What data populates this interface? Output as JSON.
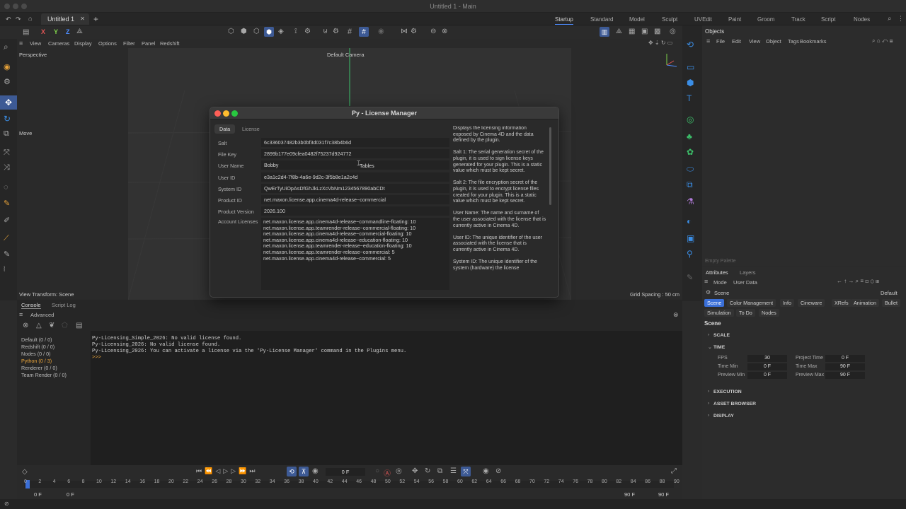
{
  "window": {
    "title": "Untitled 1 - Main"
  },
  "tabs": {
    "document_tab": "Untitled 1",
    "close": "✕",
    "add": "+"
  },
  "layouts": [
    "Startup",
    "Standard",
    "Model",
    "Sculpt",
    "UVEdit",
    "Paint",
    "Groom",
    "Track",
    "Script",
    "Nodes"
  ],
  "active_layout": "Startup",
  "viewport_menu": [
    "View",
    "Cameras",
    "Display",
    "Options",
    "Filter",
    "Panel",
    "Redshift"
  ],
  "viewport": {
    "label": "Perspective",
    "camera": "Default Camera",
    "move_tool": "Move",
    "view_transform": "View Transform: Scene",
    "grid_spacing": "Grid Spacing : 50 cm"
  },
  "axis": {
    "x": "X",
    "y": "Y",
    "z": "Z"
  },
  "dialog": {
    "title": "Py - License Manager",
    "tabs": [
      "Data",
      "License"
    ],
    "fields": [
      {
        "label": "Salt",
        "value": "6c336037482b3b0bf3d031f7c38b4b6d"
      },
      {
        "label": "File Key",
        "value": "2899b177e09cfea0482f75237d924772"
      },
      {
        "label": "User Name",
        "value": "Bobby"
      },
      {
        "label": "User ID",
        "value": "e3a1c2d4-7f8b-4a6e-9d2c-3f5b8e1a2c4d"
      },
      {
        "label": "System ID",
        "value": "QwErTyUiOpAsDfGhJkLzXcVbNm1234567890abCDt"
      },
      {
        "label": "Product ID",
        "value": "net.maxon.license.app.cinema4d-release~commercial"
      },
      {
        "label": "Product Version",
        "value": "2026.100"
      }
    ],
    "cursor_tooltip": "Tables",
    "account_licenses_label": "Account Licenses",
    "account_licenses": [
      "net.maxon.license.app.cinema4d-release~commandline-floating: 10",
      "net.maxon.license.app.teamrender-release~commercial-floating: 10",
      "net.maxon.license.app.cinema4d-release~commercial-floating: 10",
      "net.maxon.license.app.cinema4d-release~education-floating: 10",
      "net.maxon.license.app.teamrender-release~education-floating: 10",
      "net.maxon.license.app.teamrender-release~commercial: 5",
      "net.maxon.license.app.cinema4d-release~commercial: 5"
    ],
    "help": [
      "Displays the licensing information exposed by Cinema 4D and the data defined by the plugin.",
      "Salt 1: The serial generation secret of the plugin, it is used to sign license keys generated for your plugin. This is a static value which must be kept secret.",
      "Salt 2: The file encryption secret of the plugin, it is used to encrypt license files created for your plugin. This is a static value which must be kept secret.",
      "User Name: The name and surname of the user associated with the license that is currently active in Cinema 4D.",
      "User ID: The unique identifier of the user associated with the license that is currently active in Cinema 4D.",
      "System ID: The unique identifier of the system (hardware) the license"
    ]
  },
  "console": {
    "tabs": [
      "Console",
      "Script Log"
    ],
    "filter": "Advanced",
    "sources": [
      "Default (0 / 0)",
      "Redshift (0 / 0)",
      "Nodes (0 / 0)",
      "Python (0 / 3)",
      "Renderer (0 / 0)",
      "Team Render  (0 / 0)"
    ],
    "highlight_color": "#e8a33a",
    "output": [
      "Py-Licensing_Simple_2026: No valid license found.",
      "Py-Licensing_2026: No valid license found.",
      "Py-Licensing_2026: You can activate a license via the 'Py-License Manager' command in the Plugins menu."
    ],
    "prompt": ">>>"
  },
  "objects": {
    "title": "Objects",
    "menu": [
      "File",
      "Edit",
      "View",
      "Object",
      "Tags",
      "Bookmarks"
    ],
    "empty_palette": "Empty Palette"
  },
  "attributes": {
    "tabs": [
      "Attributes",
      "Layers"
    ],
    "menu": [
      "Mode",
      "User Data"
    ],
    "object_name": "Scene",
    "preset": "Default",
    "sub_tabs": [
      "Scene",
      "Color Management",
      "Info",
      "Cineware",
      "XRefs",
      "Animation",
      "Bullet",
      "Simulation",
      "To Do",
      "Nodes"
    ],
    "heading": "Scene",
    "sections": [
      "SCALE",
      "TIME",
      "EXECUTION",
      "ASSET BROWSER",
      "DISPLAY"
    ],
    "time": {
      "fps_label": "FPS",
      "fps": "30",
      "project_time_label": "Project Time",
      "project_time": "0 F",
      "time_min_label": "Time Min",
      "time_min": "0 F",
      "time_max_label": "Time Max",
      "time_max": "90 F",
      "preview_min_label": "Preview Min",
      "preview_min": "0 F",
      "preview_max_label": "Preview Max",
      "preview_max": "90 F"
    }
  },
  "timeline": {
    "current_frame": "0 F",
    "ticks": [
      "0",
      "2",
      "4",
      "6",
      "8",
      "10",
      "12",
      "14",
      "16",
      "18",
      "20",
      "22",
      "24",
      "26",
      "28",
      "30",
      "32",
      "34",
      "36",
      "38",
      "40",
      "42",
      "44",
      "46",
      "48",
      "50",
      "52",
      "54",
      "56",
      "58",
      "60",
      "62",
      "64",
      "66",
      "68",
      "70",
      "72",
      "74",
      "76",
      "78",
      "80",
      "82",
      "84",
      "86",
      "88",
      "90"
    ],
    "start_a": "0 F",
    "start_b": "0 F",
    "end_a": "90 F",
    "end_b": "90 F"
  },
  "colors": {
    "accent": "#4d8cff",
    "tool_blue": "#3b8ee6",
    "tool_green": "#3cc06a",
    "close_red": "#ff5f57",
    "min_yellow": "#febc2e",
    "max_green": "#28c840"
  }
}
